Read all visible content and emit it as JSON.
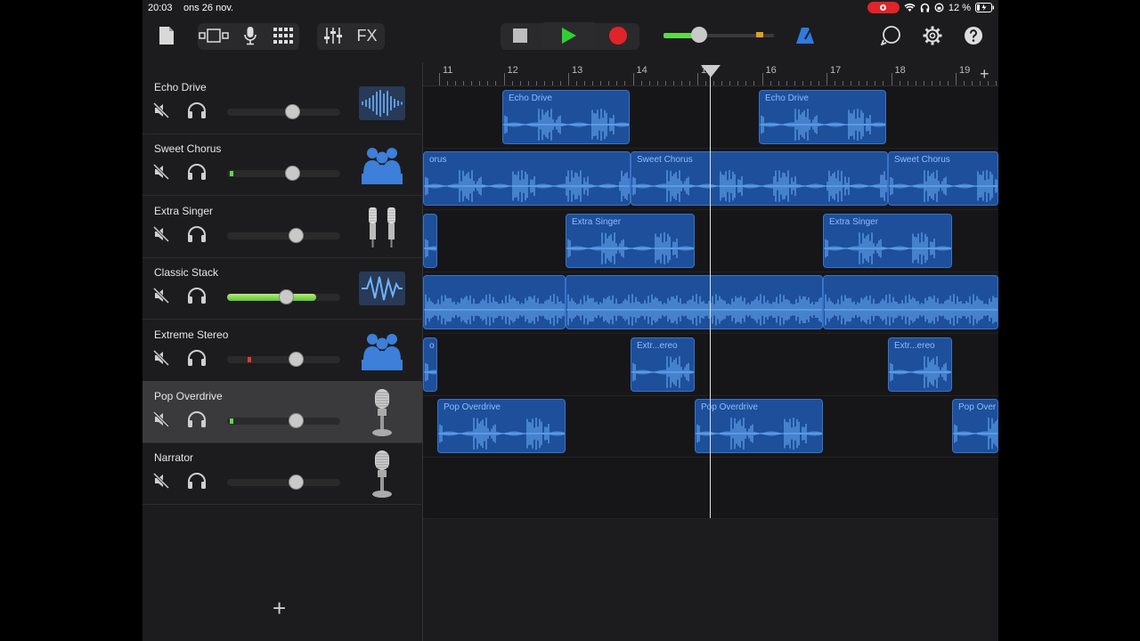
{
  "status": {
    "time": "20:03",
    "date": "ons 26 nov.",
    "battery": "12 %"
  },
  "toolbar": {
    "fx_label": "FX"
  },
  "ruler": {
    "bars": [
      "11",
      "12",
      "13",
      "14",
      "15",
      "16",
      "17",
      "18",
      "19"
    ]
  },
  "tracks": [
    {
      "name": "Echo Drive",
      "icon": "waveform-icon"
    },
    {
      "name": "Sweet Chorus",
      "icon": "choir-icon"
    },
    {
      "name": "Extra Singer",
      "icon": "microphones-icon"
    },
    {
      "name": "Classic Stack",
      "icon": "waveform-zigzag-icon"
    },
    {
      "name": "Extreme Stereo",
      "icon": "choir-icon"
    },
    {
      "name": "Pop Overdrive",
      "icon": "microphone-icon"
    },
    {
      "name": "Narrator",
      "icon": "microphone-icon"
    }
  ],
  "regions": {
    "echo_drive": "Echo Drive",
    "sweet_chorus_cut": "orus",
    "sweet_chorus": "Sweet Chorus",
    "extra_singer": "Extra Singer",
    "extreme_stereo_cut": "o",
    "extreme_stereo": "Extr...ereo",
    "pop_overdrive": "Pop Overdrive",
    "pop_overdrive_cut": "Pop Over"
  },
  "colors": {
    "region": "#1d4f9a",
    "record": "#e0242a",
    "play": "#2fd12f",
    "accent": "#2f7be0"
  }
}
